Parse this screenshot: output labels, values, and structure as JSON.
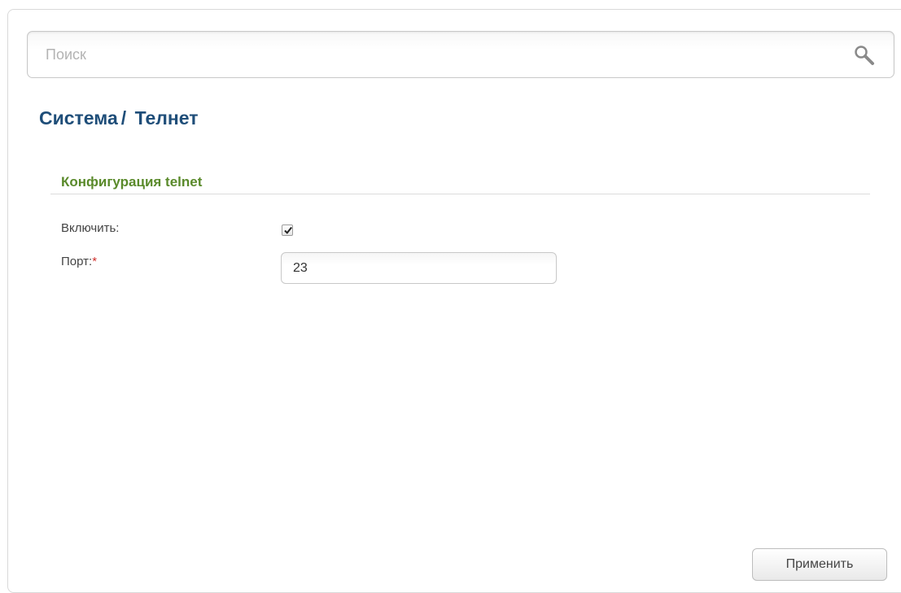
{
  "search": {
    "placeholder": "Поиск",
    "icon": "search-icon"
  },
  "breadcrumb": {
    "parent": "Система",
    "separator": "/",
    "current": "Телнет"
  },
  "section": {
    "title": "Конфигурация telnet"
  },
  "form": {
    "enable_label": "Включить:",
    "enable_checked": true,
    "port_label": "Порт:",
    "port_required_mark": "*",
    "port_value": "23"
  },
  "actions": {
    "apply_label": "Применить"
  },
  "colors": {
    "title": "#1f4e79",
    "section_title": "#5a8a2b",
    "required": "#d0312d"
  }
}
